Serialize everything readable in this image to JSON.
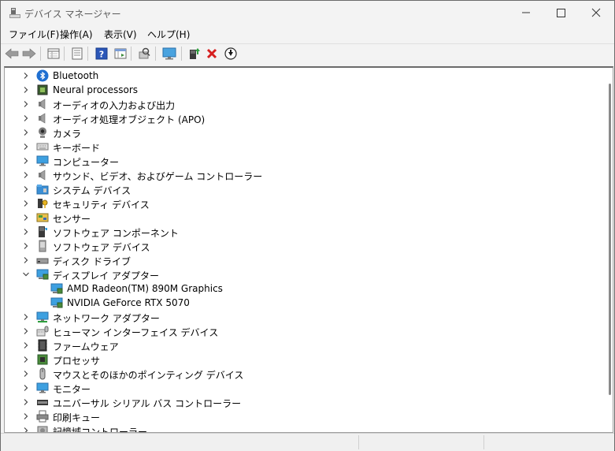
{
  "window": {
    "title": "デバイス マネージャー"
  },
  "menu": [
    "ファイル(F)",
    "操作(A)",
    "表示(V)",
    "ヘルプ(H)"
  ],
  "toolbar_icons": [
    "back-arrow",
    "forward-arrow",
    "properties-grid",
    "print-list",
    "help-book",
    "view-panel",
    "scan-hardware",
    "computer-monitor",
    "add-driver",
    "uninstall-x",
    "update-download"
  ],
  "tree": {
    "items": [
      {
        "label": "Bluetooth",
        "icon": "bluetooth-icon",
        "expanded": false,
        "level": 0
      },
      {
        "label": "Neural processors",
        "icon": "chip-icon",
        "expanded": false,
        "level": 0
      },
      {
        "label": "オーディオの入力および出力",
        "icon": "speaker-icon",
        "expanded": false,
        "level": 0
      },
      {
        "label": "オーディオ処理オブジェクト (APO)",
        "icon": "speaker-icon",
        "expanded": false,
        "level": 0
      },
      {
        "label": "カメラ",
        "icon": "camera-icon",
        "expanded": false,
        "level": 0
      },
      {
        "label": "キーボード",
        "icon": "keyboard-icon",
        "expanded": false,
        "level": 0
      },
      {
        "label": "コンピューター",
        "icon": "monitor-icon",
        "expanded": false,
        "level": 0
      },
      {
        "label": "サウンド、ビデオ、およびゲーム コントローラー",
        "icon": "speaker-icon",
        "expanded": false,
        "level": 0
      },
      {
        "label": "システム デバイス",
        "icon": "folder-icon",
        "expanded": false,
        "level": 0
      },
      {
        "label": "セキュリティ デバイス",
        "icon": "key-icon",
        "expanded": false,
        "level": 0
      },
      {
        "label": "センサー",
        "icon": "sensor-icon",
        "expanded": false,
        "level": 0
      },
      {
        "label": "ソフトウェア コンポーネント",
        "icon": "software-icon",
        "expanded": false,
        "level": 0
      },
      {
        "label": "ソフトウェア デバイス",
        "icon": "device-icon",
        "expanded": false,
        "level": 0
      },
      {
        "label": "ディスク ドライブ",
        "icon": "disk-icon",
        "expanded": false,
        "level": 0
      },
      {
        "label": "ディスプレイ アダプター",
        "icon": "display-adapter-icon",
        "expanded": true,
        "level": 0
      },
      {
        "label": "AMD Radeon(TM) 890M Graphics",
        "icon": "display-adapter-icon",
        "expanded": null,
        "level": 1
      },
      {
        "label": "NVIDIA GeForce RTX 5070",
        "icon": "display-adapter-icon",
        "expanded": null,
        "level": 1
      },
      {
        "label": "ネットワーク アダプター",
        "icon": "network-icon",
        "expanded": false,
        "level": 0
      },
      {
        "label": "ヒューマン インターフェイス デバイス",
        "icon": "hid-icon",
        "expanded": false,
        "level": 0
      },
      {
        "label": "ファームウェア",
        "icon": "firmware-icon",
        "expanded": false,
        "level": 0
      },
      {
        "label": "プロセッサ",
        "icon": "processor-icon",
        "expanded": false,
        "level": 0
      },
      {
        "label": "マウスとそのほかのポインティング デバイス",
        "icon": "mouse-icon",
        "expanded": false,
        "level": 0
      },
      {
        "label": "モニター",
        "icon": "monitor-icon",
        "expanded": false,
        "level": 0
      },
      {
        "label": "ユニバーサル シリアル バス コントローラー",
        "icon": "usb-icon",
        "expanded": false,
        "level": 0
      },
      {
        "label": "印刷キュー",
        "icon": "printer-icon",
        "expanded": false,
        "level": 0
      },
      {
        "label": "記憶域コントローラー",
        "icon": "storage-icon",
        "expanded": false,
        "level": 0
      }
    ]
  },
  "colors": {
    "accent": "#0078d4",
    "window_bg": "#f3f3f3",
    "tree_bg": "#ffffff"
  }
}
